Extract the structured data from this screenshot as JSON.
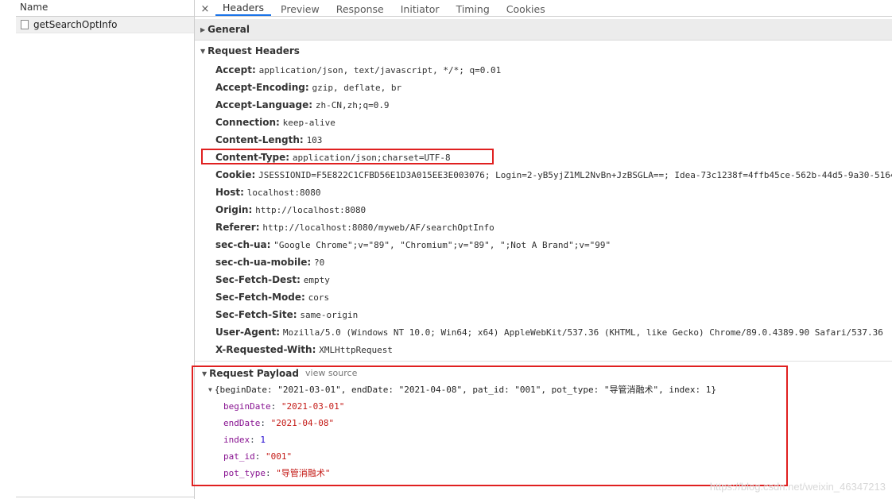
{
  "name_pane": {
    "header": "Name",
    "items": [
      "getSearchOptInfo"
    ]
  },
  "tabs": {
    "close": "×",
    "items": [
      "Headers",
      "Preview",
      "Response",
      "Initiator",
      "Timing",
      "Cookies"
    ]
  },
  "sections": {
    "general": "General",
    "request_headers": "Request Headers"
  },
  "request_headers": [
    {
      "name": "Accept:",
      "value": "application/json, text/javascript, */*; q=0.01"
    },
    {
      "name": "Accept-Encoding:",
      "value": "gzip, deflate, br"
    },
    {
      "name": "Accept-Language:",
      "value": "zh-CN,zh;q=0.9"
    },
    {
      "name": "Connection:",
      "value": "keep-alive"
    },
    {
      "name": "Content-Length:",
      "value": "103"
    },
    {
      "name": "Content-Type:",
      "value": "application/json;charset=UTF-8"
    },
    {
      "name": "Cookie:",
      "value": "JSESSIONID=F5E822C1CFBD56E1D3A015EE3E003076; Login=2-yB5yjZ1ML2NvBn+JzBSGLA==; Idea-73c1238f=4ffb45ce-562b-44d5-9a30-5164"
    },
    {
      "name": "Host:",
      "value": "localhost:8080"
    },
    {
      "name": "Origin:",
      "value": "http://localhost:8080"
    },
    {
      "name": "Referer:",
      "value": "http://localhost:8080/myweb/AF/searchOptInfo"
    },
    {
      "name": "sec-ch-ua:",
      "value": "\"Google Chrome\";v=\"89\", \"Chromium\";v=\"89\", \";Not A Brand\";v=\"99\""
    },
    {
      "name": "sec-ch-ua-mobile:",
      "value": "?0"
    },
    {
      "name": "Sec-Fetch-Dest:",
      "value": "empty"
    },
    {
      "name": "Sec-Fetch-Mode:",
      "value": "cors"
    },
    {
      "name": "Sec-Fetch-Site:",
      "value": "same-origin"
    },
    {
      "name": "User-Agent:",
      "value": "Mozilla/5.0 (Windows NT 10.0; Win64; x64) AppleWebKit/537.36 (KHTML, like Gecko) Chrome/89.0.4389.90 Safari/537.36"
    },
    {
      "name": "X-Requested-With:",
      "value": "XMLHttpRequest"
    }
  ],
  "payload": {
    "title": "Request Payload",
    "view_source": "view source",
    "summary": "{beginDate: \"2021-03-01\", endDate: \"2021-04-08\", pat_id: \"001\", pot_type: \"导管消融术\", index: 1}",
    "fields": [
      {
        "key": "beginDate",
        "value": "\"2021-03-01\"",
        "kind": "string"
      },
      {
        "key": "endDate",
        "value": "\"2021-04-08\"",
        "kind": "string"
      },
      {
        "key": "index",
        "value": "1",
        "kind": "number"
      },
      {
        "key": "pat_id",
        "value": "\"001\"",
        "kind": "string"
      },
      {
        "key": "pot_type",
        "value": "\"导管消融术\"",
        "kind": "string"
      }
    ]
  },
  "watermark": "https://blog.csdn.net/weixin_46347213",
  "colors": {
    "highlight": "#e02020",
    "active_tab": "#1a73e8",
    "json_key": "#881391",
    "json_string": "#c41a16",
    "json_number": "#1c00cf"
  }
}
